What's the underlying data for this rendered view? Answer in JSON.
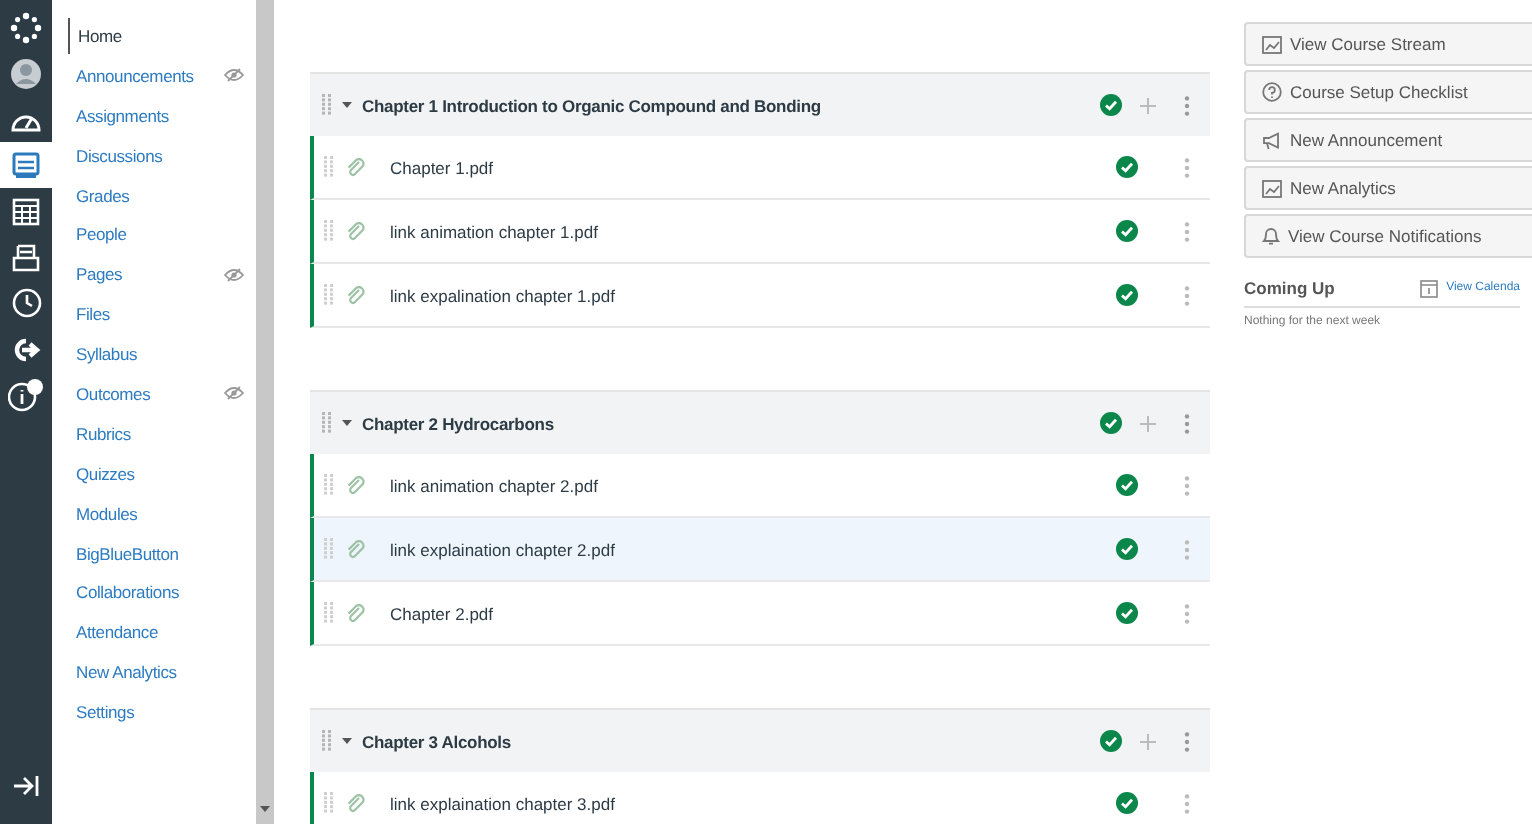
{
  "global_nav": [
    {
      "kind": "logo",
      "selected": false
    },
    {
      "kind": "account",
      "selected": false
    },
    {
      "kind": "dashboard",
      "selected": false
    },
    {
      "kind": "courses",
      "selected": true
    },
    {
      "kind": "calendar",
      "selected": false
    },
    {
      "kind": "inbox",
      "selected": false
    },
    {
      "kind": "history",
      "selected": false
    },
    {
      "kind": "commons",
      "selected": false
    },
    {
      "kind": "help",
      "selected": false,
      "badge": true
    }
  ],
  "course_nav": [
    {
      "label": "Home",
      "selected": true,
      "hidden": false
    },
    {
      "label": "Announcements",
      "selected": false,
      "hidden": true
    },
    {
      "label": "Assignments",
      "selected": false,
      "hidden": false
    },
    {
      "label": "Discussions",
      "selected": false,
      "hidden": false
    },
    {
      "label": "Grades",
      "selected": false,
      "hidden": false
    },
    {
      "label": "People",
      "selected": false,
      "hidden": false
    },
    {
      "label": "Pages",
      "selected": false,
      "hidden": true
    },
    {
      "label": "Files",
      "selected": false,
      "hidden": false
    },
    {
      "label": "Syllabus",
      "selected": false,
      "hidden": false
    },
    {
      "label": "Outcomes",
      "selected": false,
      "hidden": true
    },
    {
      "label": "Rubrics",
      "selected": false,
      "hidden": false
    },
    {
      "label": "Quizzes",
      "selected": false,
      "hidden": false
    },
    {
      "label": "Modules",
      "selected": false,
      "hidden": false
    },
    {
      "label": "BigBlueButton",
      "selected": false,
      "hidden": false
    },
    {
      "label": "Collaborations",
      "selected": false,
      "hidden": false
    },
    {
      "label": "Attendance",
      "selected": false,
      "hidden": false
    },
    {
      "label": "New Analytics",
      "selected": false,
      "hidden": false
    },
    {
      "label": "Settings",
      "selected": false,
      "hidden": false
    }
  ],
  "modules": [
    {
      "title": "Chapter 1 Introduction to Organic Compound and Bonding",
      "expanded": true,
      "published": true,
      "items": [
        {
          "title": "Chapter 1.pdf",
          "published": true,
          "highlighted": false
        },
        {
          "title": "link animation chapter 1.pdf",
          "published": true,
          "highlighted": false
        },
        {
          "title": "link expalination chapter 1.pdf",
          "published": true,
          "highlighted": false
        }
      ]
    },
    {
      "title": "Chapter 2 Hydrocarbons",
      "expanded": true,
      "published": true,
      "items": [
        {
          "title": "link animation chapter 2.pdf",
          "published": true,
          "highlighted": false
        },
        {
          "title": "link explaination chapter 2.pdf",
          "published": true,
          "highlighted": true
        },
        {
          "title": "Chapter 2.pdf",
          "published": true,
          "highlighted": false
        }
      ]
    },
    {
      "title": "Chapter 3 Alcohols",
      "expanded": true,
      "published": true,
      "items": [
        {
          "title": "link explaination chapter 3.pdf",
          "published": true,
          "highlighted": false
        }
      ]
    }
  ],
  "sidebar_buttons": [
    {
      "kind": "stream",
      "label": "View Course Stream"
    },
    {
      "kind": "checklist",
      "label": "Course Setup Checklist"
    },
    {
      "kind": "announcement",
      "label": "New Announcement"
    },
    {
      "kind": "analytics",
      "label": "New Analytics"
    },
    {
      "kind": "notifications",
      "label": "View Course Notifications"
    }
  ],
  "coming_up": {
    "title": "Coming Up",
    "calendar_link": "View Calenda",
    "empty_text": "Nothing for the next week"
  }
}
